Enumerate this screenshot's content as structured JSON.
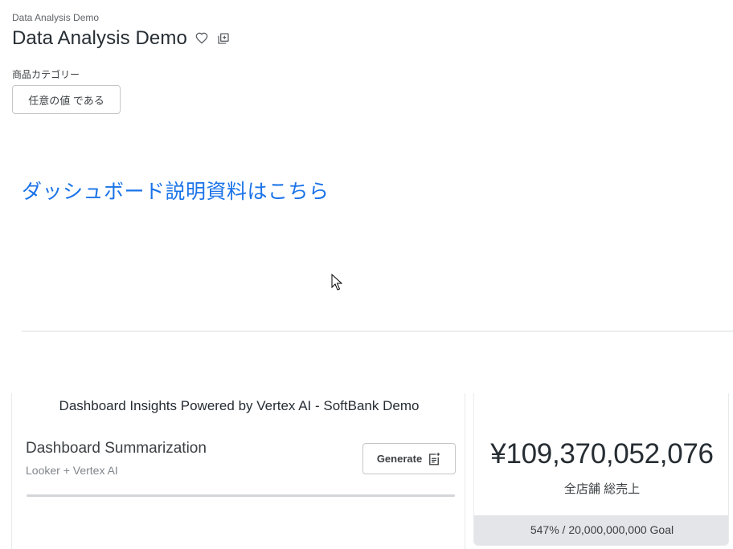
{
  "header": {
    "breadcrumb": "Data Analysis Demo",
    "title": "Data Analysis Demo",
    "favorite_icon": "heart-outline-icon",
    "copy_icon": "add-to-board-icon"
  },
  "filters": {
    "category_label": "商品カテゴリー",
    "category_value": "任意の値 である"
  },
  "content": {
    "doc_link_text": "ダッシュボード説明資料はこちら"
  },
  "insights": {
    "panel_title": "Dashboard Insights Powered by Vertex AI - SoftBank Demo",
    "summary_title": "Dashboard Summarization",
    "summary_subtitle": "Looker + Vertex AI",
    "generate_label": "Generate",
    "generate_icon": "sparkle-document-icon"
  },
  "kpi": {
    "value": "¥109,370,052,076",
    "label": "全店舗 総売上",
    "goal_text": "547% / 20,000,000,000 Goal"
  },
  "colors": {
    "link": "#1a73e8",
    "text_primary": "#262d33",
    "goal_bar": "#e3e5e8"
  }
}
